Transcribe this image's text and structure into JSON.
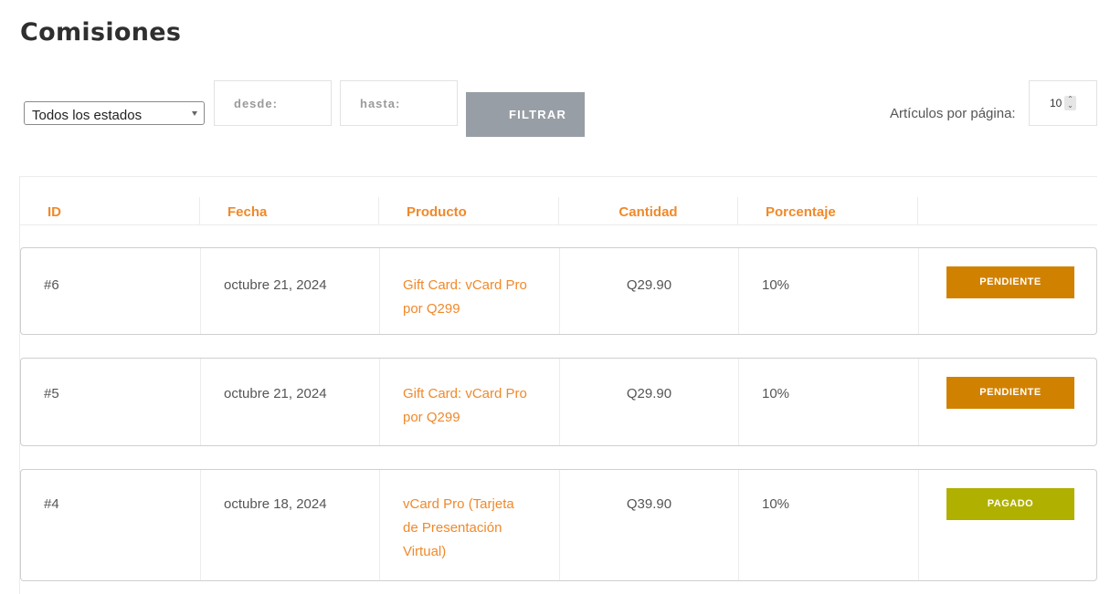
{
  "header": {
    "title": "Comisiones"
  },
  "filters": {
    "status_selected": "Todos los estados",
    "from_placeholder": "desde:",
    "to_placeholder": "hasta:",
    "filter_button": "FILTRAR",
    "per_page_label": "Artículos por página:",
    "per_page_value": "10"
  },
  "table": {
    "columns": [
      "ID",
      "Fecha",
      "Producto",
      "Cantidad",
      "Porcentaje",
      ""
    ],
    "rows": [
      {
        "id": "#6",
        "date": "octubre 21, 2024",
        "product_lines": [
          "Gift Card: vCard Pro",
          "por Q299"
        ],
        "amount": "Q29.90",
        "percent": "10%",
        "status": "PENDIENTE",
        "status_color": "#d18100"
      },
      {
        "id": "#5",
        "date": "octubre 21, 2024",
        "product_lines": [
          "Gift Card: vCard Pro",
          "por Q299"
        ],
        "amount": "Q29.90",
        "percent": "10%",
        "status": "PENDIENTE",
        "status_color": "#d18100"
      },
      {
        "id": "#4",
        "date": "octubre 18, 2024",
        "product_lines": [
          "vCard Pro (Tarjeta",
          "de Presentación",
          "Virtual)"
        ],
        "amount": "Q39.90",
        "percent": "10%",
        "status": "PAGADO",
        "status_color": "#b0b000"
      }
    ]
  },
  "colors": {
    "accent": "#f0892a",
    "filter_button_bg": "#989ea6",
    "pending": "#d18100",
    "paid": "#b0b000"
  }
}
